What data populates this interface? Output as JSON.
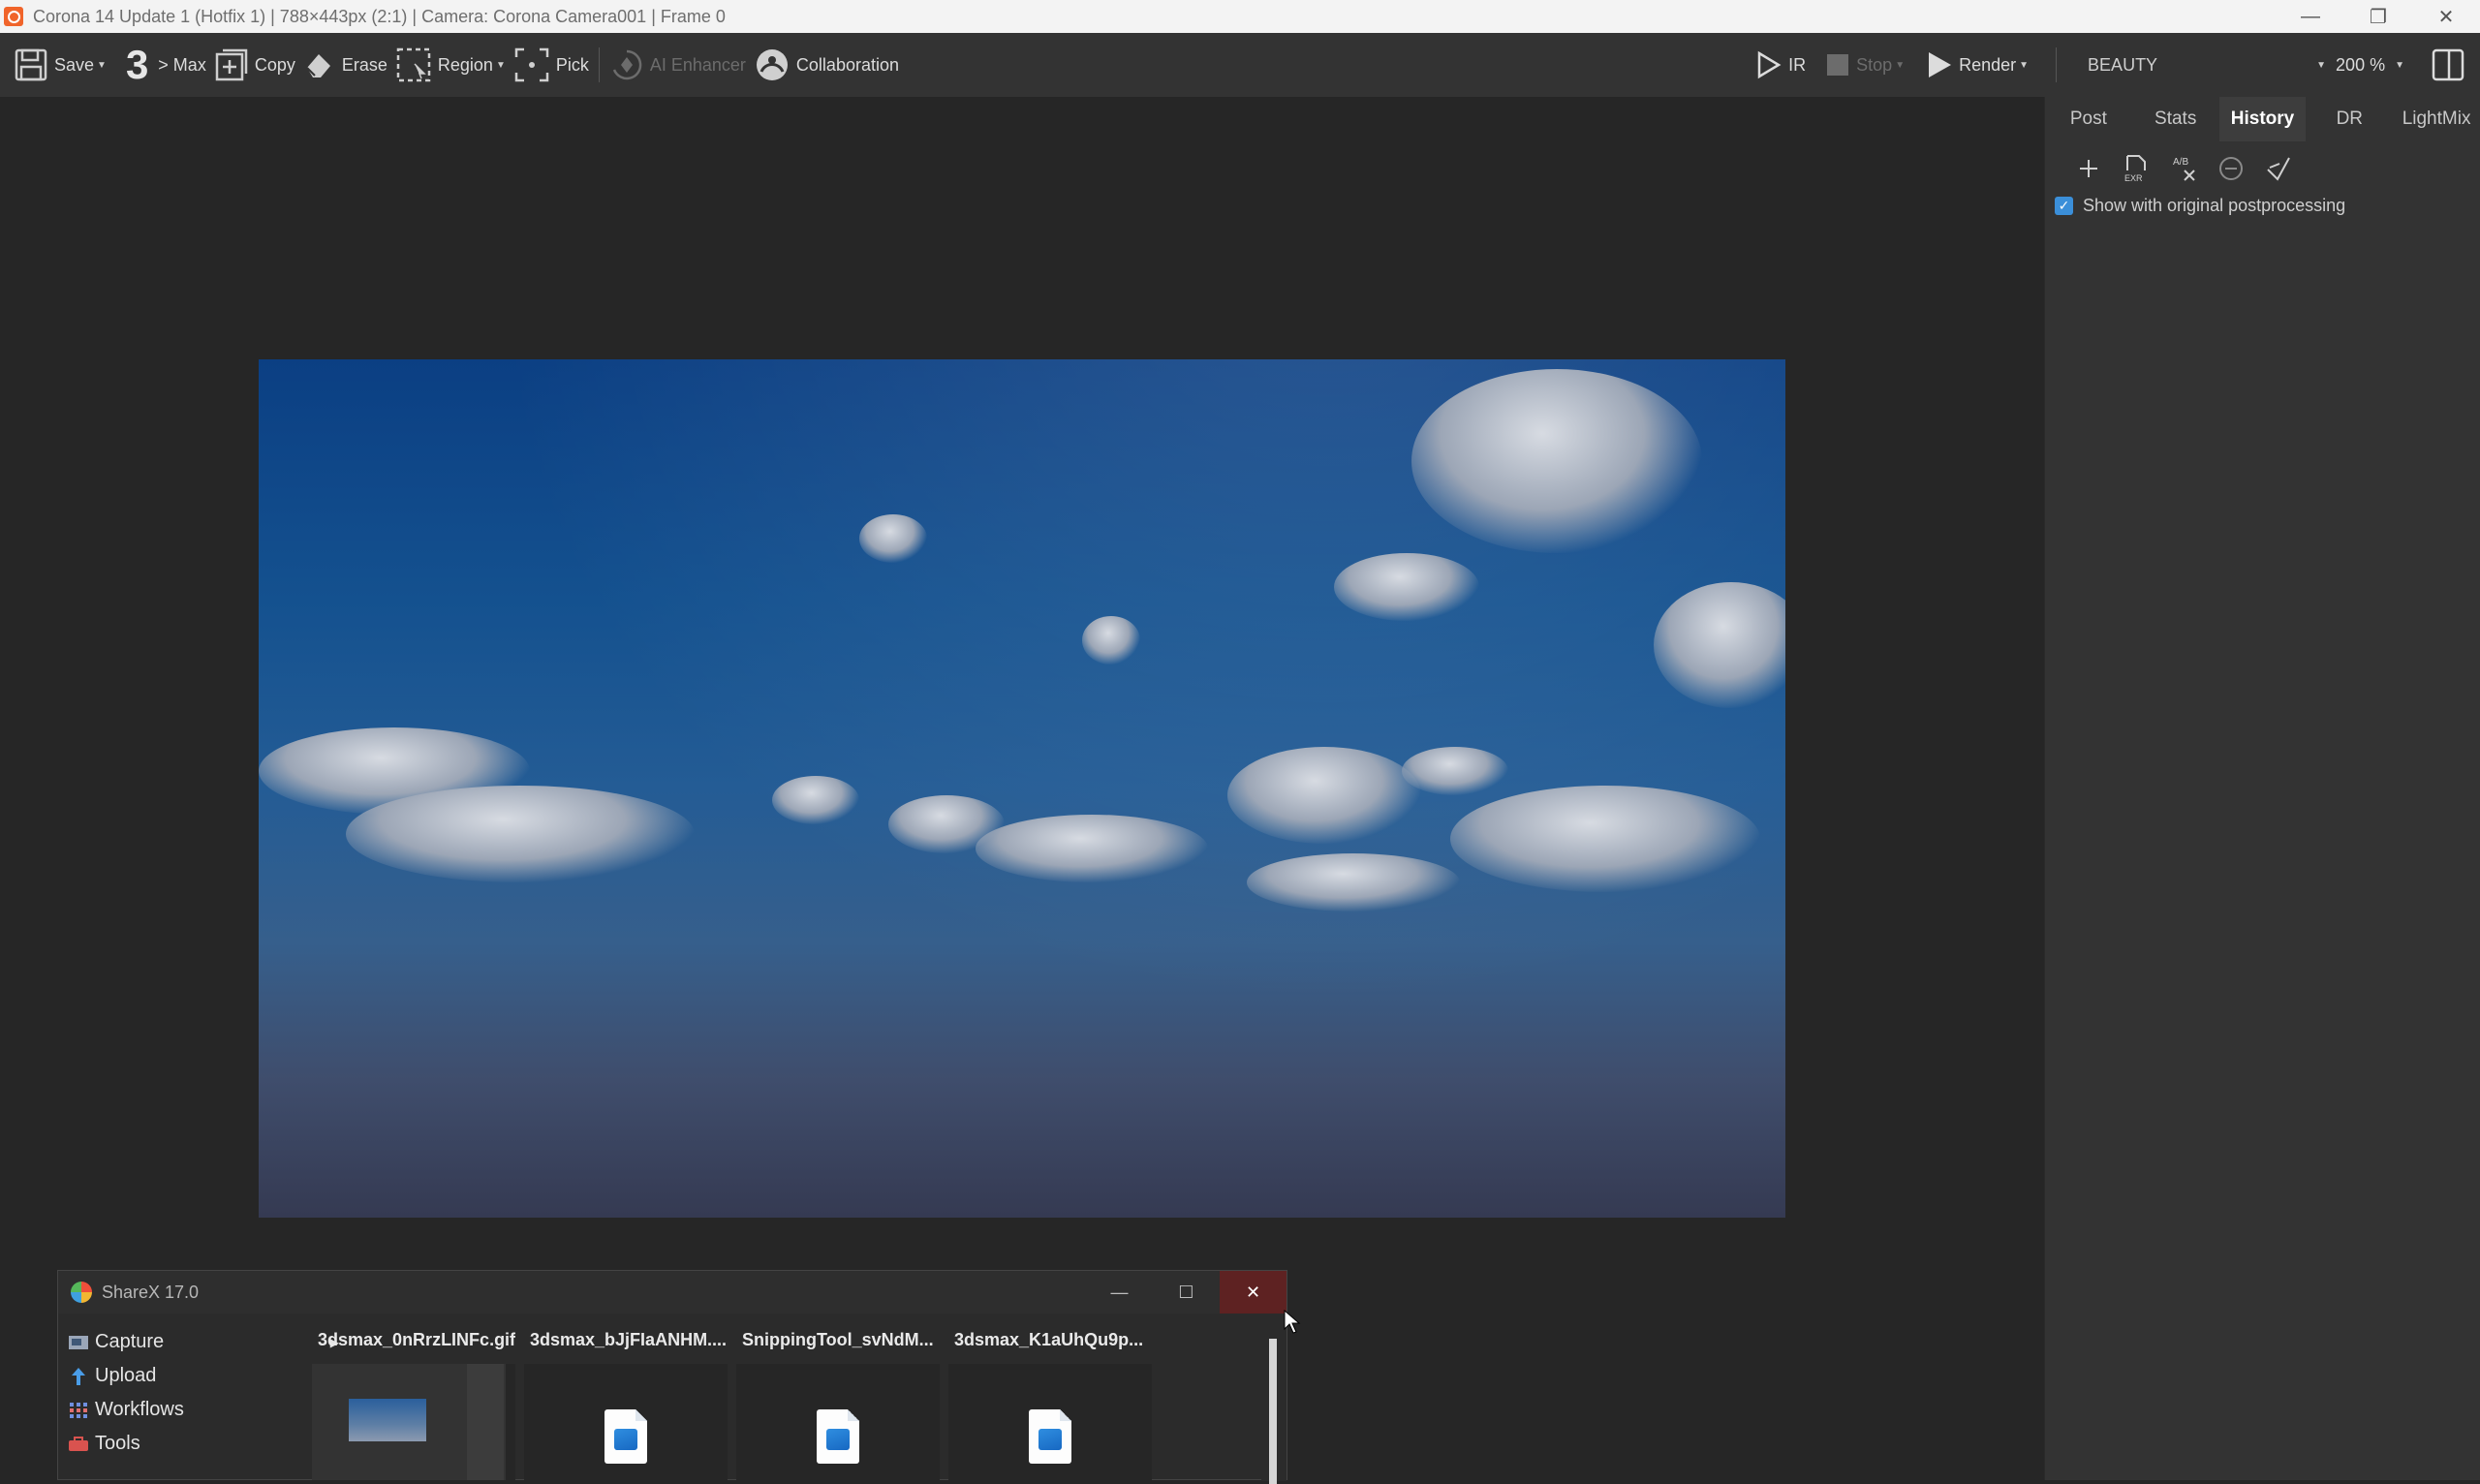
{
  "window": {
    "title": "Corona 14 Update 1 (Hotfix 1) | 788×443px (2:1) | Camera: Corona Camera001 | Frame 0",
    "minimize_icon": "minimize-icon",
    "restore_icon": "restore-icon",
    "close_icon": "close-icon"
  },
  "toolbar": {
    "save_label": "Save",
    "max_number": "3",
    "max_label": "> Max",
    "copy_label": "Copy",
    "erase_label": "Erase",
    "region_label": "Region",
    "pick_label": "Pick",
    "ai_enhancer_label": "AI Enhancer",
    "collaboration_label": "Collaboration",
    "ir_label": "IR",
    "stop_label": "Stop",
    "render_label": "Render",
    "render_element": "BEAUTY",
    "zoom": "200 %"
  },
  "panel": {
    "tabs": [
      {
        "label": "Post",
        "active": false
      },
      {
        "label": "Stats",
        "active": false
      },
      {
        "label": "History",
        "active": true
      },
      {
        "label": "DR",
        "active": false
      },
      {
        "label": "LightMix",
        "active": false
      }
    ],
    "history_tools": [
      "add-icon",
      "save-exr-icon",
      "ab-compare-icon",
      "remove-icon",
      "clear-icon"
    ],
    "exr_label": "EXR",
    "ab_label": "A/B",
    "show_original_label": "Show with original postprocessing",
    "show_original_checked": true
  },
  "sharex": {
    "title": "ShareX 17.0",
    "menu": [
      {
        "label": "Capture",
        "icon": "capture-icon"
      },
      {
        "label": "Upload",
        "icon": "upload-icon"
      },
      {
        "label": "Workflows",
        "icon": "workflows-icon"
      },
      {
        "label": "Tools",
        "icon": "tools-icon"
      }
    ],
    "files": [
      {
        "name": "3dsmax_0nRrzLINFc.gif",
        "thumbnail": "screenshot"
      },
      {
        "name": "3dsmax_bJjFIaANHM....",
        "thumbnail": "image-file-icon"
      },
      {
        "name": "SnippingTool_svNdM...",
        "thumbnail": "image-file-icon"
      },
      {
        "name": "3dsmax_K1aUhQu9p...",
        "thumbnail": "image-file-icon"
      }
    ]
  },
  "colors": {
    "accent_checkbox": "#3b8fd9",
    "corona_brand": "#f0642a",
    "sharex_close": "#5e2222"
  }
}
